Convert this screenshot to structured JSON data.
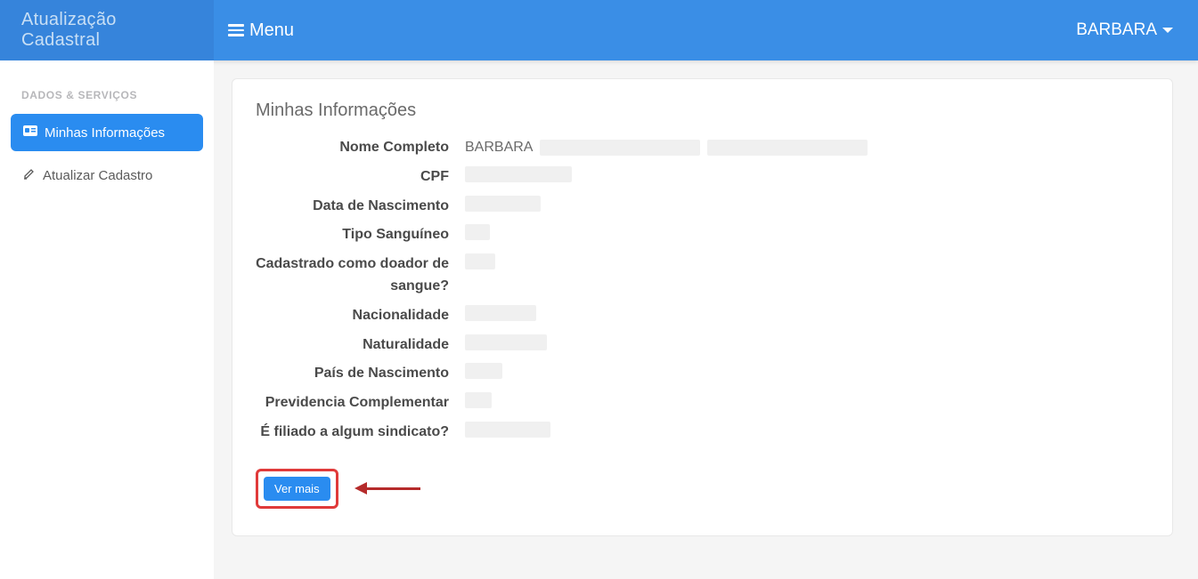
{
  "header": {
    "brand": "Atualização Cadastral",
    "menu_label": "Menu",
    "user_name": "BARBARA"
  },
  "sidebar": {
    "heading": "DADOS & SERVIÇOS",
    "items": [
      {
        "label": "Minhas Informações",
        "active": true,
        "icon": "card-icon"
      },
      {
        "label": "Atualizar Cadastro",
        "active": false,
        "icon": "pencil-icon"
      }
    ]
  },
  "card": {
    "title": "Minhas Informações",
    "fields": [
      {
        "label": "Nome Completo",
        "value": "BARBARA",
        "redacted_widths": [
          180,
          180
        ]
      },
      {
        "label": "CPF",
        "value": "",
        "redacted_widths": [
          120
        ]
      },
      {
        "label": "Data de Nascimento",
        "value": "",
        "redacted_widths": [
          85
        ]
      },
      {
        "label": "Tipo Sanguíneo",
        "value": "",
        "redacted_widths": [
          28
        ]
      },
      {
        "label": "Cadastrado como doador de sangue?",
        "value": "",
        "redacted_widths": [
          34
        ]
      },
      {
        "label": "Nacionalidade",
        "value": "",
        "redacted_widths": [
          80
        ]
      },
      {
        "label": "Naturalidade",
        "value": "",
        "redacted_widths": [
          92
        ]
      },
      {
        "label": "País de Nascimento",
        "value": "",
        "redacted_widths": [
          42
        ]
      },
      {
        "label": "Previdencia Complementar",
        "value": "",
        "redacted_widths": [
          30
        ]
      },
      {
        "label": "É filiado a algum sindicato?",
        "value": "",
        "redacted_widths": [
          96
        ]
      }
    ],
    "button_label": "Ver mais"
  }
}
